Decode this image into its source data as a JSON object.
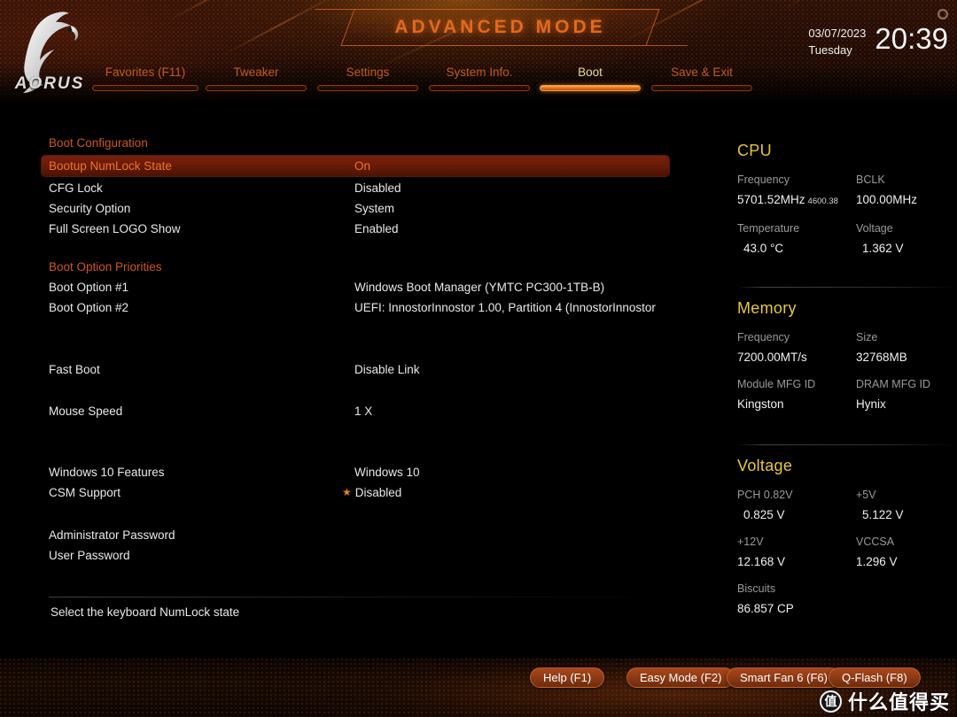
{
  "header": {
    "title": "ADVANCED MODE",
    "logo_text": "AORUS",
    "date": "03/07/2023",
    "weekday": "Tuesday",
    "time": "20:39",
    "corner_icon": "gear-icon"
  },
  "nav": {
    "tabs": [
      {
        "label": "Favorites (F11)",
        "active": false
      },
      {
        "label": "Tweaker",
        "active": false
      },
      {
        "label": "Settings",
        "active": false
      },
      {
        "label": "System Info.",
        "active": false
      },
      {
        "label": "Boot",
        "active": true
      },
      {
        "label": "Save & Exit",
        "active": false
      }
    ]
  },
  "main": {
    "groups": [
      {
        "heading": "Boot Configuration",
        "items": [
          {
            "label": "Bootup NumLock State",
            "value": "On",
            "selected": true
          },
          {
            "label": "CFG Lock",
            "value": "Disabled",
            "selected": false
          },
          {
            "label": "Security Option",
            "value": "System",
            "selected": false
          },
          {
            "label": "Full Screen LOGO Show",
            "value": "Enabled",
            "selected": false
          }
        ]
      },
      {
        "heading": "Boot Option Priorities",
        "items": [
          {
            "label": "Boot Option #1",
            "value": "Windows Boot Manager (YMTC PC300-1TB-B)",
            "selected": false
          },
          {
            "label": "Boot Option #2",
            "value": "UEFI: InnostorInnostor 1.00, Partition 4 (InnostorInnostor",
            "selected": false
          }
        ]
      },
      {
        "heading": "",
        "items": [
          {
            "label": "Fast Boot",
            "value": "Disable Link",
            "selected": false
          },
          {
            "label": "Mouse Speed",
            "value": "1 X",
            "selected": false
          }
        ]
      },
      {
        "heading": "",
        "items": [
          {
            "label": "Windows 10 Features",
            "value": "Windows 10",
            "selected": false
          },
          {
            "label": "CSM Support",
            "value": "Disabled",
            "selected": false,
            "star": "★"
          }
        ]
      },
      {
        "heading": "",
        "items": [
          {
            "label": "Administrator Password",
            "value": "",
            "selected": false
          },
          {
            "label": "User Password",
            "value": "",
            "selected": false
          }
        ]
      }
    ],
    "help_text": "Select the keyboard NumLock state"
  },
  "sidebar": {
    "panels": [
      {
        "title": "CPU",
        "fields": [
          {
            "key": "Frequency",
            "value": "5701.52MHz",
            "sub": "4600.38"
          },
          {
            "key": "BCLK",
            "value": "100.00MHz",
            "sub": ""
          },
          {
            "key": "Temperature",
            "value": "43.0 °C",
            "sub": "",
            "indent": true
          },
          {
            "key": "Voltage",
            "value": "1.362 V",
            "sub": "",
            "indent": true
          }
        ]
      },
      {
        "title": "Memory",
        "fields": [
          {
            "key": "Frequency",
            "value": "7200.00MT/s",
            "sub": ""
          },
          {
            "key": "Size",
            "value": "32768MB",
            "sub": ""
          },
          {
            "key": "Module MFG ID",
            "value": "Kingston",
            "sub": ""
          },
          {
            "key": "DRAM MFG ID",
            "value": "Hynix",
            "sub": ""
          }
        ]
      },
      {
        "title": "Voltage",
        "fields": [
          {
            "key": "PCH 0.82V",
            "value": "0.825 V",
            "sub": "",
            "indent": true
          },
          {
            "key": "+5V",
            "value": "5.122 V",
            "sub": "",
            "indent": true
          },
          {
            "key": "+12V",
            "value": "12.168 V",
            "sub": ""
          },
          {
            "key": "VCCSA",
            "value": "1.296 V",
            "sub": ""
          },
          {
            "key": "Biscuits",
            "value": "86.857 CP",
            "sub": ""
          },
          {
            "key": "",
            "value": "",
            "sub": ""
          }
        ]
      }
    ]
  },
  "footer": {
    "buttons": [
      {
        "label": "Help (F1)"
      },
      {
        "label": "Easy Mode (F2)"
      },
      {
        "label": "Smart Fan 6 (F6)"
      },
      {
        "label": "Q-Flash (F8)"
      }
    ],
    "watermark_badge": "值",
    "watermark_text": "什么值得买"
  },
  "colors": {
    "accent_orange": "#e06a1e",
    "tab_inactive": "#c25a22",
    "tab_active": "#e8dc9a",
    "panel_title": "#e9c646",
    "selected_bg": "#6a1c08",
    "selected_text": "#f0742a"
  }
}
